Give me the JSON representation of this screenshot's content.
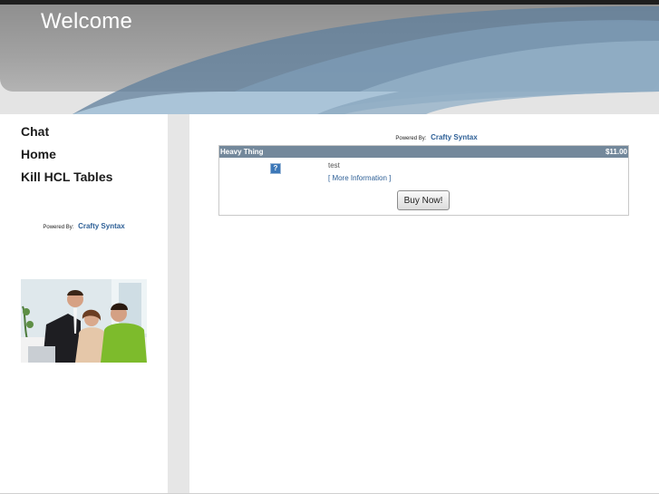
{
  "header": {
    "title": "Welcome"
  },
  "sidebar": {
    "nav": [
      {
        "label": "Chat"
      },
      {
        "label": "Home"
      },
      {
        "label": "Kill HCL Tables"
      }
    ],
    "powered_by": {
      "prefix": "Powered By:",
      "brand": "Crafty Syntax"
    }
  },
  "main": {
    "powered_by": {
      "prefix": "Powered By:",
      "brand": "Crafty Syntax"
    },
    "product": {
      "name": "Heavy Thing",
      "price": "$11.00",
      "thumb_glyph": "?",
      "description": "test",
      "more_info": "[ More Information ]",
      "buy_label": "Buy Now!"
    }
  },
  "colors": {
    "banner_gray": "#9a9a9a",
    "swoosh_blue": "#6e8aa3",
    "link_blue": "#2d5f96",
    "product_header": "#73889b"
  }
}
